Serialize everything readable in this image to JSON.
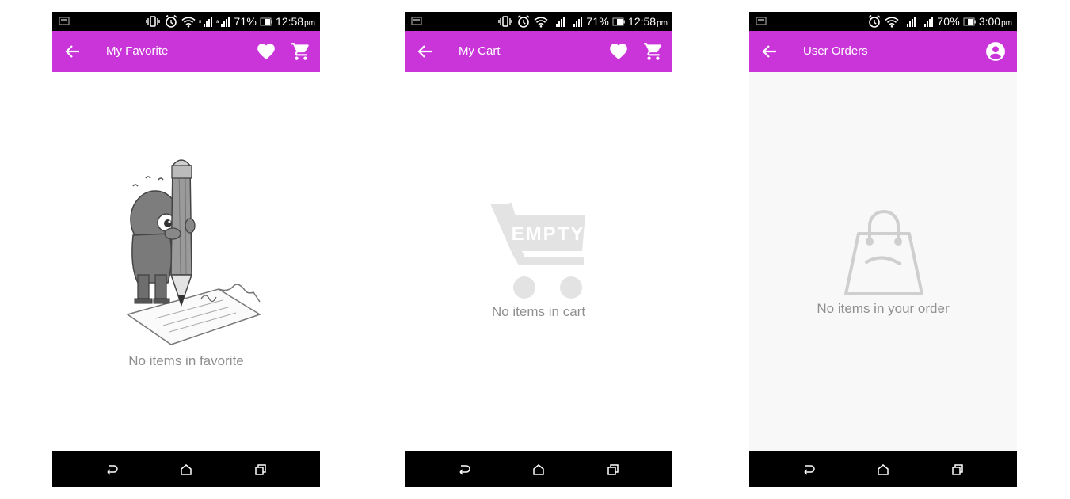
{
  "theme": {
    "accent": "#c935d9",
    "status_bar": "#000000",
    "nav_bar": "#000000",
    "empty_text": "#8f8f8f"
  },
  "screens": [
    {
      "status": {
        "icons": [
          "vibrate-icon",
          "alarm-icon",
          "wifi-icon",
          "signal-icon",
          "signal-icon"
        ],
        "battery": "71%",
        "time": "12:58",
        "ampm": "pm"
      },
      "appbar": {
        "title": "My Favorite",
        "actions": [
          "heart-icon",
          "cart-icon"
        ]
      },
      "empty": {
        "illustration": "drawing-character",
        "message": "No items in favorite"
      },
      "navbar": [
        "back-icon",
        "home-icon",
        "recents-icon"
      ]
    },
    {
      "status": {
        "icons": [
          "vibrate-icon",
          "alarm-icon",
          "wifi-icon",
          "signal-icon",
          "signal-icon"
        ],
        "battery": "71%",
        "time": "12:58",
        "ampm": "pm"
      },
      "appbar": {
        "title": "My Cart",
        "actions": [
          "heart-icon",
          "cart-icon"
        ]
      },
      "empty": {
        "illustration": "empty-cart",
        "badge": "EMPTY",
        "message": "No items in cart"
      },
      "navbar": [
        "back-icon",
        "home-icon",
        "recents-icon"
      ]
    },
    {
      "status": {
        "icons": [
          "alarm-icon",
          "wifi-icon",
          "signal-icon",
          "signal-icon"
        ],
        "battery": "70%",
        "time": "3:00",
        "ampm": "pm"
      },
      "appbar": {
        "title": "User Orders",
        "actions": [
          "account-icon"
        ]
      },
      "empty": {
        "illustration": "sad-shopping-bag",
        "message": "No items in your order"
      },
      "navbar": [
        "back-icon",
        "home-icon",
        "recents-icon"
      ]
    }
  ]
}
